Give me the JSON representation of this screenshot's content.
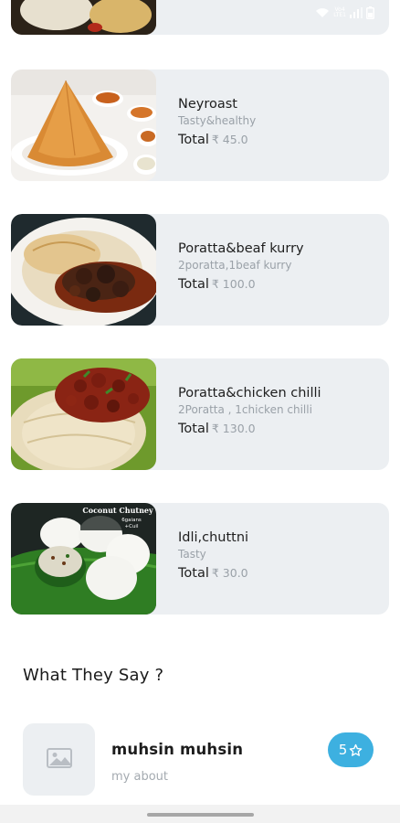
{
  "status_bar": {
    "icons": [
      "wifi-icon",
      "volte-icon",
      "signal-icon",
      "battery-icon"
    ],
    "volte_line1": "Vo4",
    "volte_line2": "LTE1"
  },
  "menu": {
    "total_label": "Total",
    "items": [
      {
        "name": "Neyroast",
        "description": "Tasty&healthy",
        "price": "₹ 45.0"
      },
      {
        "name": "Poratta&beaf kurry",
        "description": "2poratta,1beaf kurry",
        "price": "₹ 100.0"
      },
      {
        "name": "Poratta&chicken chilli",
        "description": "2Poratta , 1chicken chilli",
        "price": "₹ 130.0"
      },
      {
        "name": "Idli,chuttni",
        "description": "Tasty",
        "price": "₹ 30.0"
      }
    ],
    "photo_caption": {
      "line1": "Coconut Chutney",
      "line2": "6gaians",
      "line3": "+Cuil"
    }
  },
  "reviews": {
    "title": "What They Say ?",
    "items": [
      {
        "name": "muhsin muhsin",
        "about": "my about",
        "rating": "5",
        "rating_icon": "star-outline-icon",
        "avatar_icon": "image-placeholder-icon"
      }
    ]
  },
  "colors": {
    "card_bg": "#eceff2",
    "accent": "#3db0e0",
    "muted_text": "#9aa1a8",
    "primary_text": "#1e1e1e"
  }
}
